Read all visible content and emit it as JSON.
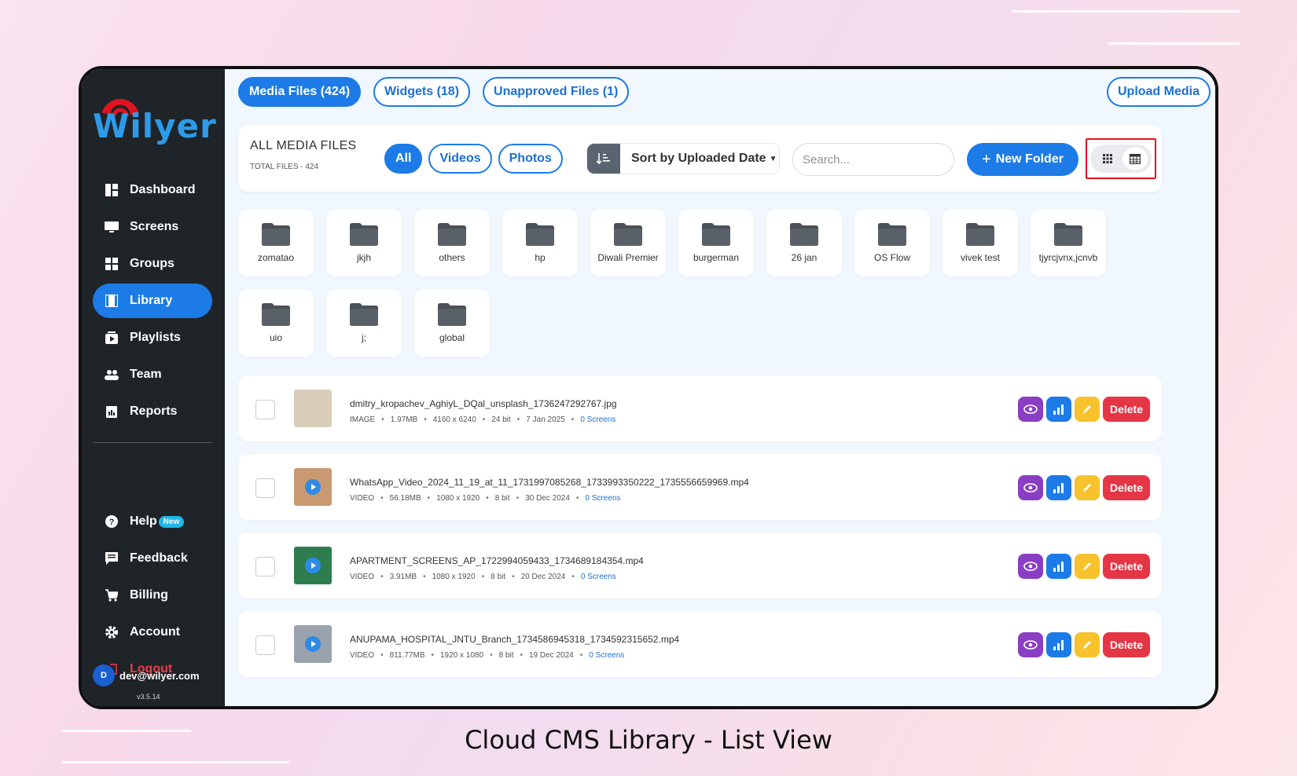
{
  "sidebar": {
    "brand": "Wilyer",
    "items": [
      {
        "label": "Dashboard",
        "icon": "dashboard-icon"
      },
      {
        "label": "Screens",
        "icon": "monitor-icon"
      },
      {
        "label": "Groups",
        "icon": "grid-icon"
      },
      {
        "label": "Library",
        "icon": "film-icon"
      },
      {
        "label": "Playlists",
        "icon": "playlist-icon"
      },
      {
        "label": "Team",
        "icon": "team-icon"
      },
      {
        "label": "Reports",
        "icon": "report-icon"
      }
    ],
    "items2": [
      {
        "label": "Help",
        "icon": "help-icon",
        "badge": "New"
      },
      {
        "label": "Feedback",
        "icon": "feedback-icon"
      },
      {
        "label": "Billing",
        "icon": "cart-icon"
      },
      {
        "label": "Account",
        "icon": "gear-icon"
      },
      {
        "label": "Logout",
        "icon": "logout-icon"
      }
    ],
    "user": {
      "initial": "D",
      "email": "dev@wilyer.com"
    },
    "version": "v3.5.14"
  },
  "tabs": [
    {
      "label": "Media Files (424)",
      "active": true
    },
    {
      "label": "Widgets (18)",
      "active": false
    },
    {
      "label": "Unapproved Files (1)",
      "active": false
    }
  ],
  "upload_label": "Upload Media",
  "toolbar": {
    "title": "ALL MEDIA FILES",
    "subtitle": "TOTAL FILES - 424",
    "filters": [
      "All",
      "Videos",
      "Photos"
    ],
    "sort_label": "Sort by Uploaded Date",
    "search_placeholder": "Search...",
    "new_folder_label": "New Folder"
  },
  "folders": [
    "zomatao",
    "jkjh",
    "others",
    "hp",
    "Diwali Premier",
    "burgerman",
    "26 jan",
    "OS Flow",
    "vivek test",
    "tjyrcjvnx,jcnvb",
    "uio",
    "j;",
    "global"
  ],
  "files": [
    {
      "name": "dmitry_kropachev_AghiyL_DQal_unsplash_1736247292767.jpg",
      "type": "IMAGE",
      "size": "1.97MB",
      "dims": "4160 x 6240",
      "bit": "24 bit",
      "date": "7 Jan 2025",
      "screens": "0 Screens",
      "video": false,
      "thumb_color": "#d8cdb8"
    },
    {
      "name": "WhatsApp_Video_2024_11_19_at_11_1731997085268_1733993350222_1735556659969.mp4",
      "type": "VIDEO",
      "size": "56.18MB",
      "dims": "1080 x 1920",
      "bit": "8 bit",
      "date": "30 Dec 2024",
      "screens": "0 Screens",
      "video": true,
      "thumb_color": "#c99a72"
    },
    {
      "name": "APARTMENT_SCREENS_AP_1722994059433_1734689184354.mp4",
      "type": "VIDEO",
      "size": "3.91MB",
      "dims": "1080 x 1920",
      "bit": "8 bit",
      "date": "20 Dec 2024",
      "screens": "0 Screens",
      "video": true,
      "thumb_color": "#2e7d4f"
    },
    {
      "name": "ANUPAMA_HOSPITAL_JNTU_Branch_1734586945318_1734592315652.mp4",
      "type": "VIDEO",
      "size": "811.77MB",
      "dims": "1920 x 1080",
      "bit": "8 bit",
      "date": "19 Dec 2024",
      "screens": "0 Screens",
      "video": true,
      "thumb_color": "#9aa3ad"
    }
  ],
  "delete_label": "Delete",
  "caption": "Cloud CMS Library - List View",
  "colors": {
    "accent": "#1c7be6",
    "sidebar": "#1f2429",
    "delete": "#e53645",
    "view": "#8a3ec4",
    "edit": "#f7c22b",
    "highlight": "#e0131e"
  }
}
